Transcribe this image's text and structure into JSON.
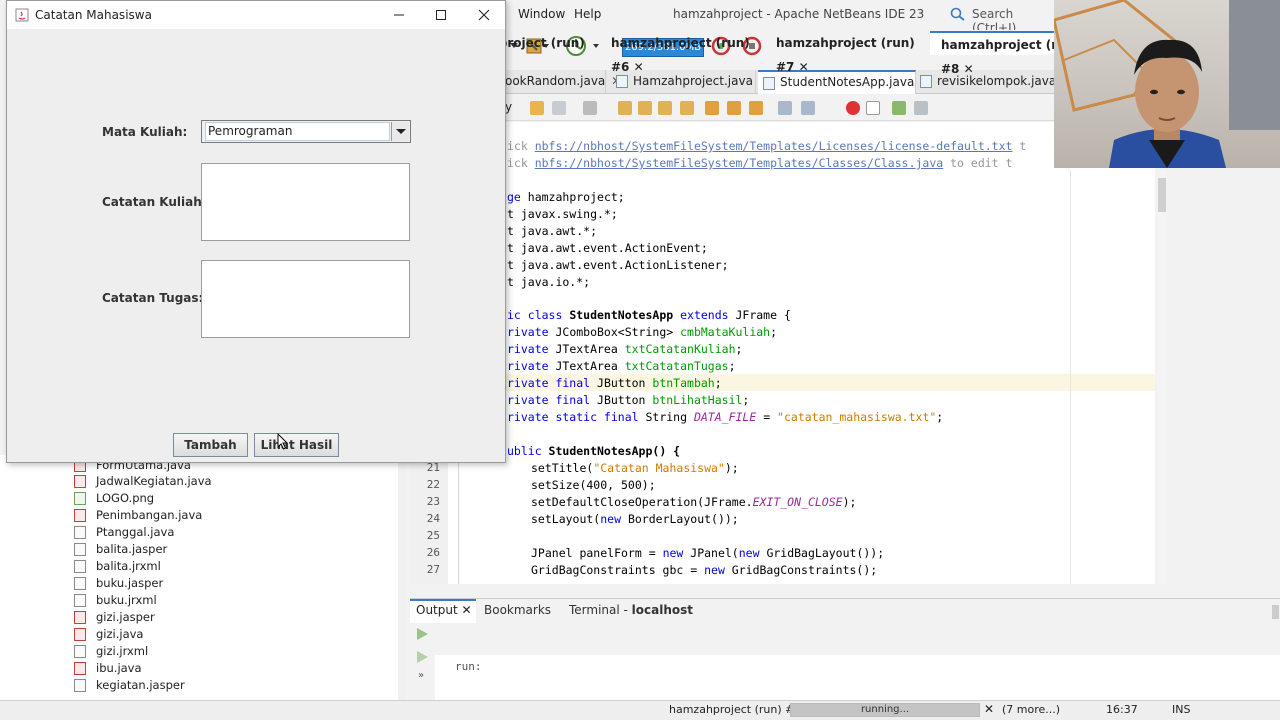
{
  "ide": {
    "menu": [
      "Window",
      "Help"
    ],
    "title": "hamzahproject - Apache NetBeans IDE 23",
    "search_placeholder": "Search (Ctrl+I)",
    "memory": "269.2/381.0MB",
    "file_tabs": [
      {
        "label": "ookRandom.java",
        "active": false
      },
      {
        "label": "Hamzahproject.java",
        "active": false
      },
      {
        "label": "StudentNotesApp.java",
        "active": true
      },
      {
        "label": "revisikelompok.java",
        "active": false
      }
    ],
    "editor_lines": [
      {
        "num": "",
        "frag": "comment1"
      },
      {
        "num": "",
        "frag": "comment2"
      },
      {
        "num": "",
        "frag": "pkg"
      },
      {
        "num": "21",
        "text": "        setTitle(\"Catatan Mahasiswa\");"
      },
      {
        "num": "22",
        "text": "        setSize(400, 500);"
      },
      {
        "num": "23",
        "text": "        setDefaultCloseOperation(JFrame.EXIT_ON_CLOSE);"
      },
      {
        "num": "24",
        "text": "        setLayout(new BorderLayout());"
      },
      {
        "num": "25",
        "text": ""
      },
      {
        "num": "26",
        "text": "        JPanel panelForm = new JPanel(new GridBagLayout());"
      },
      {
        "num": "27",
        "text": "        GridBagConstraints gbc = new GridBagConstraints();"
      }
    ],
    "code": {
      "c1a": "ick ",
      "c1link": "nbfs://nbhost/SystemFileSystem/Templates/Licenses/license-default.txt",
      "c1b": " t",
      "c2a": "ick ",
      "c2link": "nbfs://nbhost/SystemFileSystem/Templates/Classes/Class.java",
      "c2b": " to edit t",
      "l_pkg_kw": "ge",
      "l_pkg": " hamzahproject;",
      "i1": "t javax.swing.*;",
      "i2": "t java.awt.*;",
      "i3": "t java.awt.event.ActionEvent;",
      "i4": "t java.awt.event.ActionListener;",
      "i5": "t java.io.*;",
      "cls_kw": "ic class",
      "cls_name": " StudentNotesApp ",
      "cls_ext": "extends",
      "cls_rest": " JFrame {",
      "f1a": "rivate ",
      "f1t": "JComboBox<String> ",
      "f1n": "cmbMataKuliah",
      "f1e": ";",
      "f2a": "rivate ",
      "f2t": "JTextArea ",
      "f2n": "txtCatatanKuliah",
      "f2e": ";",
      "f3a": "rivate ",
      "f3t": "JTextArea ",
      "f3n": "txtCatatanTugas",
      "f3e": ";",
      "f4a": "rivate final ",
      "f4t": "JButton ",
      "f4n": "btnTambah",
      "f4e": ";",
      "f5a": "rivate final ",
      "f5t": "JButton ",
      "f5n": "btnLihatHasil",
      "f5e": ";",
      "f6a": "rivate static final ",
      "f6t": "String ",
      "f6n": "DATA_FILE",
      "f6m": " = ",
      "f6s": "\"catatan_mahasiswa.txt\"",
      "f6e": ";",
      "ctor_kw": "ublic",
      "ctor": " StudentNotesApp() {",
      "l21a": "setTitle(",
      "l21s": "\"Catatan Mahasiswa\"",
      "l21e": ");",
      "l22": "setSize(400, 500);",
      "l23a": "setDefaultCloseOperation(JFrame.",
      "l23i": "EXIT_ON_CLOSE",
      "l23e": ");",
      "l24a": "setLayout(",
      "l24k": "new",
      "l24e": " BorderLayout());",
      "l26a": "JPanel panelForm = ",
      "l26k": "new",
      "l26e": " JPanel(",
      "l26k2": "new",
      "l26e2": " GridBagLayout());",
      "l27a": "GridBagConstraints gbc = ",
      "l27k": "new",
      "l27e": " GridBagConstraints();"
    },
    "line_numbers": [
      "21",
      "22",
      "23",
      "24",
      "25",
      "26",
      "27"
    ],
    "project_files": [
      {
        "name": "FormUtama.java",
        "kind": "jv"
      },
      {
        "name": "JadwalKegiatan.java",
        "kind": "jv"
      },
      {
        "name": "LOGO.png",
        "kind": "img"
      },
      {
        "name": "Penimbangan.java",
        "kind": "jv"
      },
      {
        "name": "Ptanggal.java",
        "kind": "plain"
      },
      {
        "name": "balita.jasper",
        "kind": "plain"
      },
      {
        "name": "balita.jrxml",
        "kind": "plain"
      },
      {
        "name": "buku.jasper",
        "kind": "plain"
      },
      {
        "name": "buku.jrxml",
        "kind": "plain"
      },
      {
        "name": "gizi.jasper",
        "kind": "jv"
      },
      {
        "name": "gizi.java",
        "kind": "jv"
      },
      {
        "name": "gizi.jrxml",
        "kind": "plain"
      },
      {
        "name": "ibu.java",
        "kind": "jv"
      },
      {
        "name": "kegiatan.jasper",
        "kind": "plain"
      }
    ],
    "output": {
      "tabs": [
        "Output",
        "Bookmarks",
        "Terminal - "
      ],
      "terminal_host": "localhost",
      "run_tabs": [
        {
          "label": "hamzahproject (run) #5",
          "active": false
        },
        {
          "label": "hamzahproject (run) #6",
          "active": false
        },
        {
          "label": "hamzahproject (run) #7",
          "active": false
        },
        {
          "label": "hamzahproject (run) #8",
          "active": true
        }
      ],
      "console_text": "run:"
    },
    "status": {
      "task": "hamzahproject (run) #8",
      "progress_label": "running...",
      "more": "(7 more...)",
      "position": "16:37",
      "mode": "INS"
    }
  },
  "dialog": {
    "title": "Catatan Mahasiswa",
    "label_mata_kuliah": "Mata Kuliah:",
    "combo_value": "Pemrograman",
    "label_catatan_kuliah": "Catatan Kuliah:",
    "label_catatan_tugas": "Catatan Tugas:",
    "btn_tambah": "Tambah",
    "btn_lihat_hasil": "Lihat Hasil"
  },
  "colors": {
    "accent": "#3b78c7",
    "memory_bar": "#2b88d8",
    "keyword": "#0000e6",
    "field": "#009a00",
    "string": "#ce7b00"
  }
}
